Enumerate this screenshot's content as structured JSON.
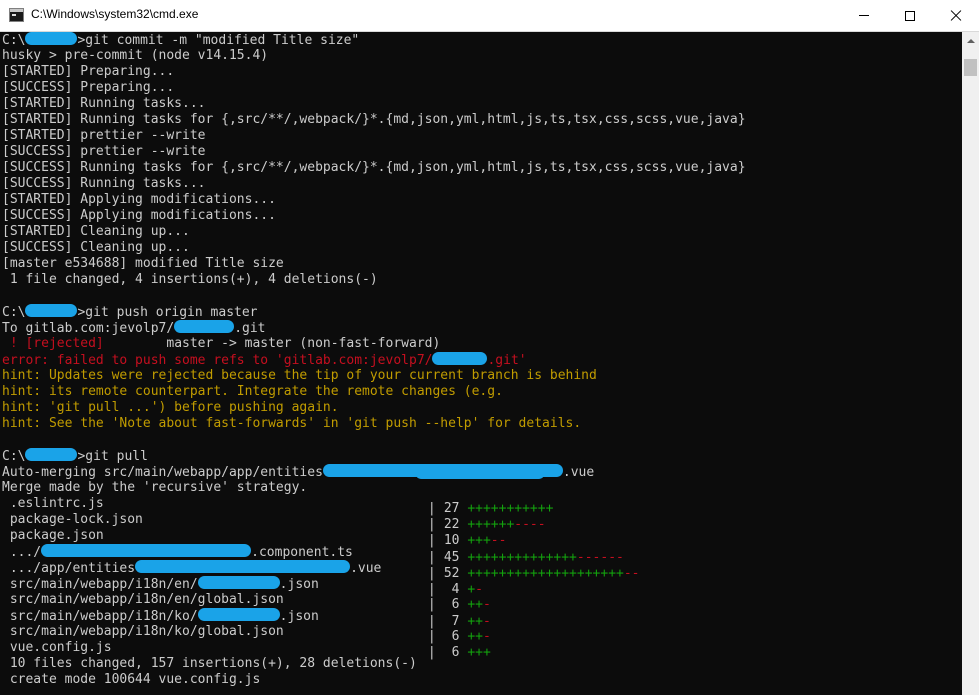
{
  "window": {
    "title": "C:\\Windows\\system32\\cmd.exe",
    "icon": "cmd-icon",
    "controls": {
      "minimize": "minimize-icon",
      "maximize": "maximize-icon",
      "close": "close-icon"
    }
  },
  "colors": {
    "background": "#0c0c0c",
    "text": "#cccccc",
    "error": "#c50f1f",
    "hint": "#c19c00",
    "additions": "#13a10e",
    "redaction": "#1aa3e8"
  },
  "console": {
    "lines": [
      {
        "type": "prompt",
        "prefix": "C:\\",
        "suffix": ">git commit -m \"modified Title size\""
      },
      {
        "text": "husky > pre-commit (node v14.15.4)"
      },
      {
        "text": "[STARTED] Preparing..."
      },
      {
        "text": "[SUCCESS] Preparing..."
      },
      {
        "text": "[STARTED] Running tasks..."
      },
      {
        "text": "[STARTED] Running tasks for {,src/**/,webpack/}*.{md,json,yml,html,js,ts,tsx,css,scss,vue,java}"
      },
      {
        "text": "[STARTED] prettier --write"
      },
      {
        "text": "[SUCCESS] prettier --write"
      },
      {
        "text": "[SUCCESS] Running tasks for {,src/**/,webpack/}*.{md,json,yml,html,js,ts,tsx,css,scss,vue,java}"
      },
      {
        "text": "[SUCCESS] Running tasks..."
      },
      {
        "text": "[STARTED] Applying modifications..."
      },
      {
        "text": "[SUCCESS] Applying modifications..."
      },
      {
        "text": "[STARTED] Cleaning up..."
      },
      {
        "text": "[SUCCESS] Cleaning up..."
      },
      {
        "text": "[master e534688] modified Title size"
      },
      {
        "text": " 1 file changed, 4 insertions(+), 4 deletions(-)"
      },
      {
        "text": ""
      },
      {
        "type": "prompt",
        "prefix": "C:\\",
        "suffix": ">git push origin master"
      },
      {
        "type": "redacted",
        "before": "To gitlab.com:jevolp7/",
        "after": ".git"
      },
      {
        "type": "rejected",
        "tag": " ! [rejected]",
        "rest": "        master -> master (non-fast-forward)"
      },
      {
        "type": "redacted",
        "color": "error",
        "before": "error: failed to push some refs to 'gitlab.com:jevolp7/",
        "after": ".git'"
      },
      {
        "color": "hint",
        "text": "hint: Updates were rejected because the tip of your current branch is behind"
      },
      {
        "color": "hint",
        "text": "hint: its remote counterpart. Integrate the remote changes (e.g."
      },
      {
        "color": "hint",
        "text": "hint: 'git pull ...') before pushing again."
      },
      {
        "color": "hint",
        "text": "hint: See the 'Note about fast-forwards' in 'git push --help' for details."
      },
      {
        "text": ""
      },
      {
        "type": "prompt",
        "prefix": "C:\\",
        "suffix": ">git pull"
      },
      {
        "type": "redacted",
        "before": "Auto-merging src/main/webapp/app/entities",
        "after": ".vue"
      },
      {
        "text": "Merge made by the 'recursive' strategy."
      },
      {
        "type": "stat",
        "file": " .eslintrc.js",
        "count": "27",
        "plus": "+++++++++++",
        "minus": ""
      },
      {
        "type": "stat",
        "file": " package-lock.json",
        "count": "22",
        "plus": "++++++",
        "minus": "----"
      },
      {
        "type": "stat",
        "file": " package.json",
        "count": "10",
        "plus": "+++",
        "minus": "--"
      },
      {
        "type": "stat",
        "redacted": true,
        "before": " .../",
        "after": ".component.ts",
        "count": "45",
        "plus": "++++++++++++++",
        "minus": "------"
      },
      {
        "type": "stat",
        "redacted": true,
        "before": " .../app/entities",
        "after": ".vue",
        "count": "52",
        "plus": "++++++++++++++++++++",
        "minus": "--"
      },
      {
        "type": "stat",
        "redacted": true,
        "before": " src/main/webapp/i18n/en/",
        "after": ".json",
        "count": "4",
        "plus": "+",
        "minus": "-"
      },
      {
        "type": "stat",
        "file": " src/main/webapp/i18n/en/global.json",
        "count": "6",
        "plus": "++",
        "minus": "-"
      },
      {
        "type": "stat",
        "redacted": true,
        "before": " src/main/webapp/i18n/ko/",
        "after": ".json",
        "count": "7",
        "plus": "++",
        "minus": "-"
      },
      {
        "type": "stat",
        "file": " src/main/webapp/i18n/ko/global.json",
        "count": "6",
        "plus": "++",
        "minus": "-"
      },
      {
        "type": "stat",
        "file": " vue.config.js",
        "count": "6",
        "plus": "+++",
        "minus": ""
      },
      {
        "text": " 10 files changed, 157 insertions(+), 28 deletions(-)"
      },
      {
        "text": " create mode 100644 vue.config.js"
      }
    ]
  }
}
